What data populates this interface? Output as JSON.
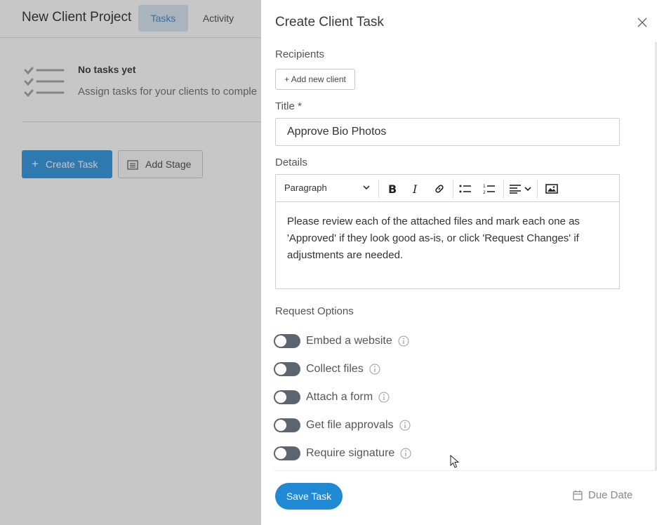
{
  "background": {
    "project_title": "New Client Project",
    "tabs": [
      "Tasks",
      "Activity"
    ],
    "empty_state": {
      "title": "No tasks yet",
      "description": "Assign tasks for your clients to comple"
    },
    "create_task_label": "Create Task",
    "add_stage_label": "Add Stage"
  },
  "panel": {
    "title": "Create Client Task",
    "recipients_label": "Recipients",
    "add_client_label": "+ Add new client",
    "title_label": "Title *",
    "title_value": "Approve Bio Photos",
    "details_label": "Details",
    "paragraph_label": "Paragraph",
    "details_text": "Please review each of the attached files and mark each one as 'Approved' if they look good as-is, or click 'Request Changes' if adjustments are needed.",
    "request_options_label": "Request Options",
    "options": [
      {
        "label": "Embed a website",
        "enabled": false
      },
      {
        "label": "Collect files",
        "enabled": false
      },
      {
        "label": "Attach a form",
        "enabled": false
      },
      {
        "label": "Get file approvals",
        "enabled": false
      },
      {
        "label": "Require signature",
        "enabled": false
      }
    ],
    "save_label": "Save Task",
    "due_date_label": "Due Date"
  },
  "colors": {
    "accent": "#1f8ad3",
    "create_button": "#3b9be0",
    "toggle_off": "#5c6470"
  }
}
